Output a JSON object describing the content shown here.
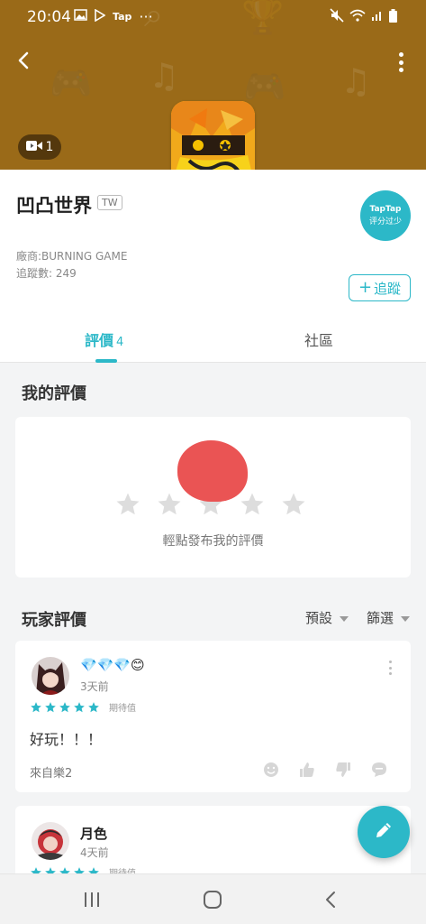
{
  "status_bar": {
    "time": "20:04",
    "tap_label": "Tap",
    "more": "···"
  },
  "header": {
    "video_count": "1",
    "accent_color": "#9a6a18"
  },
  "app": {
    "title": "凹凸世界",
    "region": "TW",
    "score_badge_line1": "TapTap",
    "score_badge_line2": "评分过少",
    "vendor": "廠商:BURNING GAME",
    "followers": "追蹤數: 249",
    "follow_label": "追蹤"
  },
  "tabs": [
    {
      "label": "評價",
      "count": "4"
    },
    {
      "label": "社區"
    }
  ],
  "my_review": {
    "title": "我的評價",
    "hint": "輕點發布我的評價"
  },
  "player_reviews": {
    "title": "玩家評價",
    "sort_label": "預設",
    "filter_label": "篩選"
  },
  "reviews": [
    {
      "username": "💎💎💎😊",
      "time_ago": "3天前",
      "stars": 5,
      "rating_label": "期待值",
      "text": "好玩！！！",
      "source": "來自樂2"
    },
    {
      "username": "月色",
      "time_ago": "4天前",
      "stars": 5,
      "rating_label": "期待值"
    }
  ],
  "colors": {
    "accent": "#2cb8c8",
    "star_empty": "#dddddd",
    "blob": "#ea5454"
  }
}
